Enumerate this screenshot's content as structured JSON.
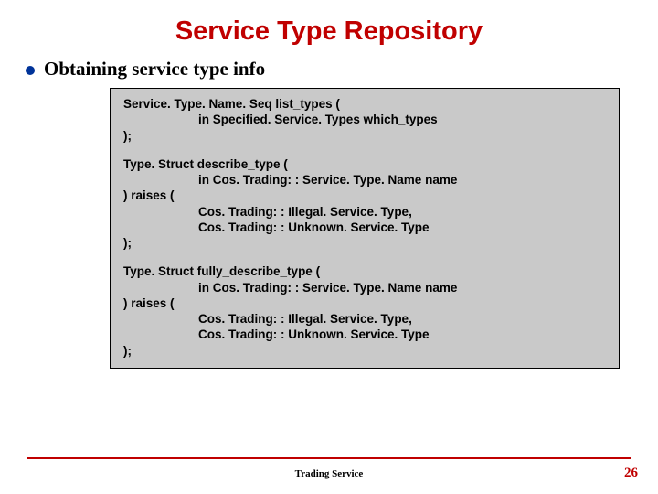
{
  "title": "Service Type Repository",
  "bullet": "Obtaining service type info",
  "code": {
    "b1_sig": "Service. Type. Name. Seq list_types (",
    "b1_arg": "in Specified. Service. Types which_types",
    "b1_end": ");",
    "b2_sig": "Type. Struct describe_type (",
    "b2_arg": "in Cos. Trading: : Service. Type. Name name",
    "b2_raises": ") raises (",
    "b2_r1": "Cos. Trading: : Illegal. Service. Type,",
    "b2_r2": "Cos. Trading: : Unknown. Service. Type",
    "b2_end": ");",
    "b3_sig": "Type. Struct fully_describe_type (",
    "b3_arg": "in Cos. Trading: : Service. Type. Name name",
    "b3_raises": ") raises (",
    "b3_r1": "Cos. Trading: : Illegal. Service. Type,",
    "b3_r2": "Cos. Trading: : Unknown. Service. Type",
    "b3_end": ");"
  },
  "footer": "Trading Service",
  "page": "26"
}
